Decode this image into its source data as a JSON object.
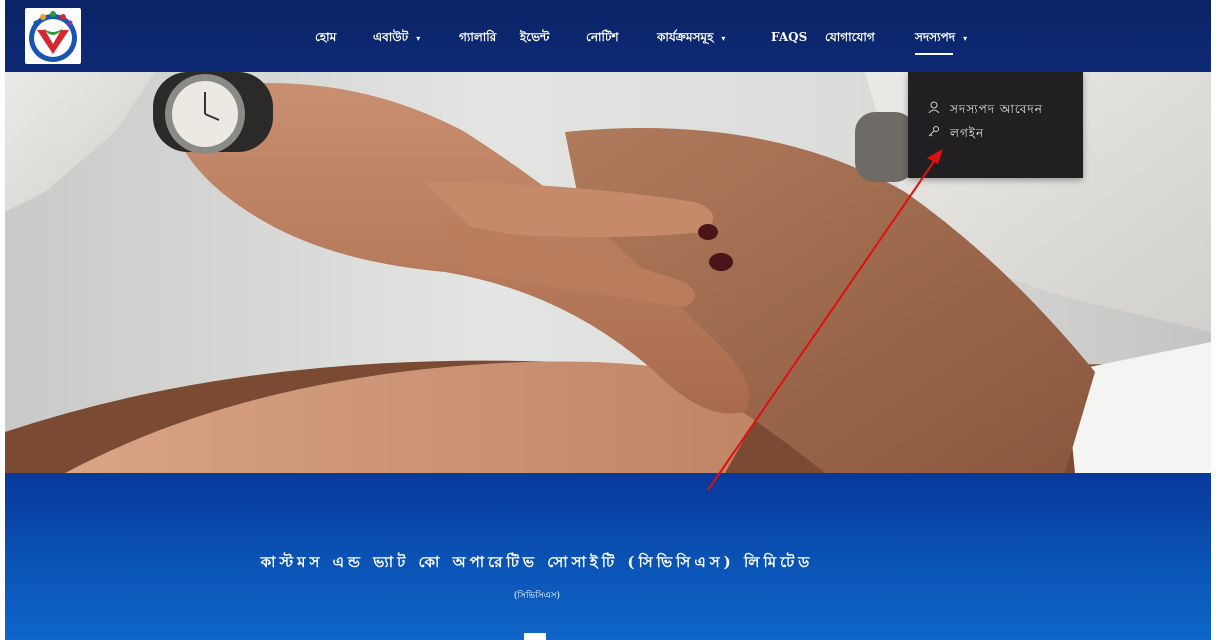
{
  "colors": {
    "navbar": "#0c2a75",
    "dropdown": "#221f22",
    "band_top": "#08399a",
    "band_bottom": "#0f66c8",
    "annotation_arrow": "#e01010"
  },
  "logo": {
    "icon": "cooperative-logo-icon"
  },
  "nav": {
    "items": [
      {
        "label": "হোম",
        "has_caret": false
      },
      {
        "label": "এবাউট",
        "has_caret": true
      },
      {
        "label": "গ্যালারি",
        "has_caret": false
      },
      {
        "label": "ইভেন্ট",
        "has_caret": false
      },
      {
        "label": "নোটিশ",
        "has_caret": false
      },
      {
        "label": "কার্যক্রমসমূহ",
        "has_caret": true
      },
      {
        "label": "FAQS",
        "has_caret": false
      },
      {
        "label": "যোগাযোগ",
        "has_caret": false
      },
      {
        "label": "সদস্যপদ",
        "has_caret": true,
        "active": true
      }
    ],
    "caret": "▾"
  },
  "dropdown": {
    "items": [
      {
        "label": "সদস্যপদ আবেদন",
        "icon": "user-icon"
      },
      {
        "label": "লগইন",
        "icon": "key-icon"
      }
    ]
  },
  "hero": {
    "image": "stacked-hands-teamwork-photo"
  },
  "band": {
    "title": "কাস্টমস এন্ড ভ্যাট কো অপারেটিভ সোসাইটি (সিভিসিএস) লিমিটেড",
    "abbr": "(সিভিসিএস)"
  }
}
